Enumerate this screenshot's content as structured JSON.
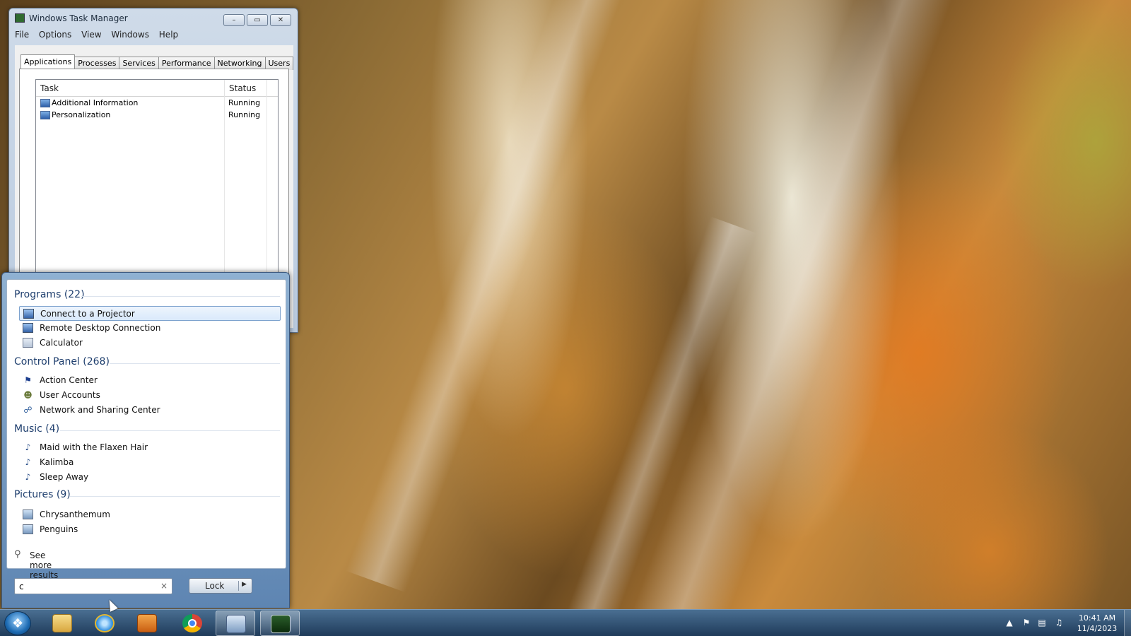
{
  "task_manager": {
    "title": "Windows Task Manager",
    "menu": [
      "File",
      "Options",
      "View",
      "Windows",
      "Help"
    ],
    "tabs": [
      "Applications",
      "Processes",
      "Services",
      "Performance",
      "Networking",
      "Users"
    ],
    "active_tab": "Applications",
    "columns": {
      "task": "Task",
      "status": "Status"
    },
    "tasks": [
      {
        "name": "Additional Information",
        "status": "Running"
      },
      {
        "name": "Personalization",
        "status": "Running"
      }
    ],
    "caption_buttons": {
      "minimize": "–",
      "maximize": "▭",
      "close": "✕"
    }
  },
  "start_menu": {
    "groups": [
      {
        "title": "Programs (22)",
        "items": [
          "Connect to a Projector",
          "Remote Desktop Connection",
          "Calculator"
        ]
      },
      {
        "title": "Control Panel (268)",
        "items": [
          "Action Center",
          "User Accounts",
          "Network and Sharing Center"
        ]
      },
      {
        "title": "Music (4)",
        "items": [
          "Maid with the Flaxen Hair",
          "Kalimba",
          "Sleep Away"
        ]
      },
      {
        "title": "Pictures (9)",
        "items": [
          "Chrysanthemum",
          "Penguins"
        ]
      }
    ],
    "selected_item": "Connect to a Projector",
    "see_more": "See more results",
    "search": {
      "value": "c",
      "clear": "×"
    },
    "lock_button": {
      "label": "Lock",
      "arrow": "▶"
    }
  },
  "taskbar": {
    "clock": {
      "time": "10:41 AM",
      "date": "11/4/2023"
    },
    "pinned": [
      "windows-explorer",
      "internet-explorer",
      "windows-media-player",
      "google-chrome",
      "remote-desktop",
      "task-manager"
    ],
    "tray": {
      "expand": "▲"
    }
  },
  "colors": {
    "selection_border": "#7da2ce",
    "group_title": "#1f3f6e",
    "taskbar": "#1f3b5a"
  }
}
